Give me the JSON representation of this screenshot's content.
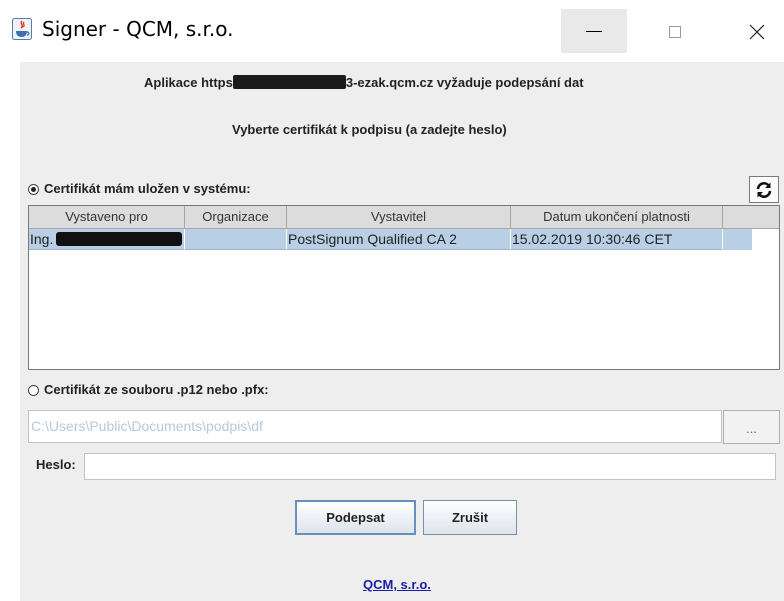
{
  "window": {
    "title": "Signer - QCM, s.r.o.",
    "minimize_glyph": "—",
    "maximize_glyph": "☐",
    "close_glyph": "✕"
  },
  "header": {
    "info_prefix": "Aplikace https",
    "info_suffix": "3-ezak.qcm.cz vyžaduje podepsání dat",
    "instruction": "Vyberte certifikát k podpisu (a zadejte heslo)"
  },
  "system_cert": {
    "selected": true,
    "label": "Certifikát mám uložen v systému:",
    "refresh_icon": "refresh-icon"
  },
  "table": {
    "columns": [
      "Vystaveno pro",
      "Organizace",
      "Vystavitel",
      "Datum ukončení platnosti"
    ],
    "rows": [
      {
        "issued_to": "Ing.",
        "organization": "",
        "issuer": "PostSignum Qualified CA 2",
        "valid_until": "15.02.2019 10:30:46 CET"
      }
    ]
  },
  "file_cert": {
    "selected": false,
    "label": "Certifikát ze souboru .p12 nebo .pfx:",
    "path": "C:\\Users\\Public\\Documents\\podpis\\df",
    "browse_label": "..."
  },
  "password": {
    "label": "Heslo:",
    "value": ""
  },
  "actions": {
    "sign_label": "Podepsat",
    "cancel_label": "Zrušit"
  },
  "footer": {
    "link_text": "QCM, s.r.o."
  },
  "colors": {
    "dialog_bg": "#eeeeee",
    "selection": "#b8cfe5",
    "link": "#1a1aa8"
  }
}
